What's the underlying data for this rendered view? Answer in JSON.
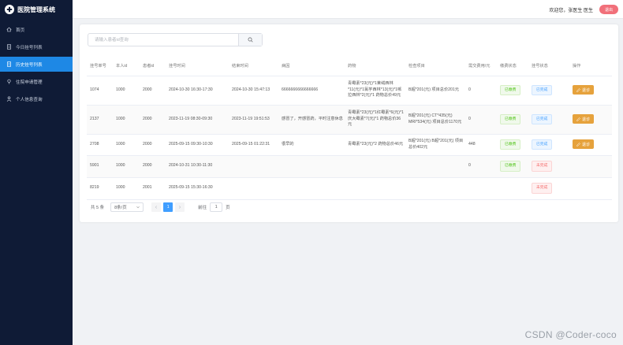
{
  "app": {
    "title": "医院管理系统"
  },
  "sidebar": {
    "items": [
      {
        "label": "首页",
        "icon": "home-icon",
        "active": false
      },
      {
        "label": "今日挂号列表",
        "icon": "document-icon",
        "active": false
      },
      {
        "label": "历史挂号列表",
        "icon": "document-icon",
        "active": true
      },
      {
        "label": "住院申请管理",
        "icon": "pin-icon",
        "active": false
      },
      {
        "label": "个人信息查询",
        "icon": "user-icon",
        "active": false
      }
    ]
  },
  "topbar": {
    "welcome": "欢迎您，张医生 医生",
    "logout_label": "退出"
  },
  "search": {
    "placeholder": "请输入患者id查询",
    "value": ""
  },
  "table": {
    "headers": [
      "挂号单号",
      "本人id",
      "患者id",
      "挂号时间",
      "结束时间",
      "病因",
      "药物",
      "检查项目",
      "需交费用/元",
      "缴费状态",
      "挂号状态",
      "操作"
    ],
    "rows": [
      {
        "cells": [
          "1074",
          "1000",
          "2000",
          "2024-10-30 16:30-17:30",
          "2024-10-30 15:47:13",
          "6666666666666666",
          "青霉素*23(元)*1莱绒西林*11(元)*1氯芋西林*13(元)*1哌拉西林*2(元)*1 药物总价49元",
          "B超*201(元) 项目总价201元",
          "0"
        ],
        "pay_status": "已缴费",
        "reg_status": "已完成",
        "action": "退诊"
      },
      {
        "cells": [
          "2137",
          "1000",
          "2000",
          "2023-11-19 08:30-09:30",
          "2023-11-19 19:51:53",
          "感冒了，开感冒药，平时注意休息",
          "青霉素*23(元)*1红霉素*6(元)*1庆大霉素*7(元)*1 药物总价36元",
          "B超*201(元) CT*435(元) MRI*534(元) 项目总价1170元",
          "0"
        ],
        "pay_status": "已缴费",
        "reg_status": "已完成",
        "action": "退诊"
      },
      {
        "cells": [
          "2708",
          "1000",
          "2000",
          "2025-09-15 09:30-10:30",
          "2025-09-15 01:22:31",
          "很早的",
          "青霉素*23(元)*2 药物总价46元",
          "B超*201(元) B超*201(元) 项目总价402元",
          "448"
        ],
        "pay_status": "已缴费",
        "reg_status": "已完成",
        "action": "退诊"
      },
      {
        "cells": [
          "5901",
          "1000",
          "2000",
          "2024-10-31 10:30-11:30",
          "",
          "",
          "",
          "",
          "0"
        ],
        "pay_status": "已缴费",
        "reg_status": "未完成",
        "action": ""
      },
      {
        "cells": [
          "8219",
          "1000",
          "2001",
          "2025-09-15 15:30-16:30",
          "",
          "",
          "",
          "",
          ""
        ],
        "pay_status": "",
        "reg_status": "未完成",
        "action": ""
      }
    ]
  },
  "pagination": {
    "total_text": "共 5 条",
    "page_size": "8条/页",
    "current_page": "1",
    "goto_label": "前往",
    "goto_value": "1",
    "page_unit": "页"
  },
  "watermark": "CSDN @Coder-coco",
  "colors": {
    "sidebar_bg": "#0f1b36",
    "active_nav": "#1e88e5",
    "logout": "#f1707a",
    "action_button": "#e6a23c",
    "success": "#52c41a",
    "info": "#409eff",
    "danger": "#f56c6c"
  }
}
